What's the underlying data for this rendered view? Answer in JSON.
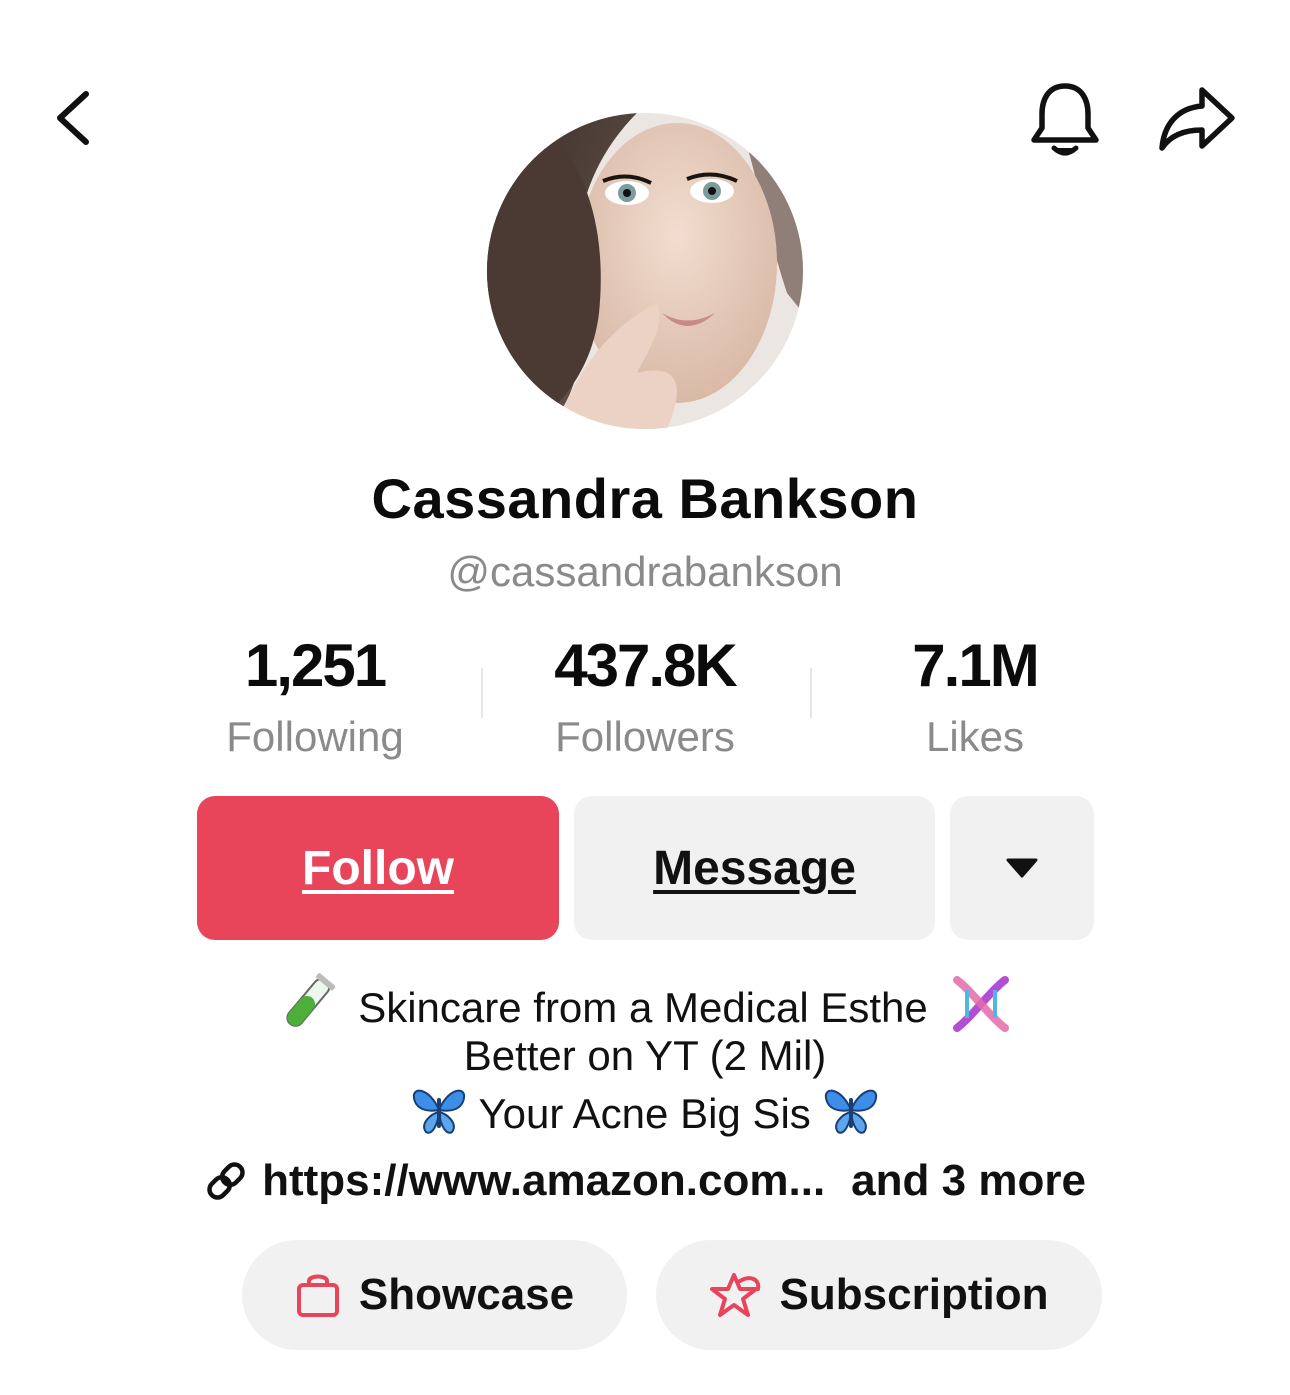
{
  "header": {
    "back_icon": "chevron-left-icon",
    "bell_icon": "bell-icon",
    "share_icon": "share-arrow-icon"
  },
  "profile": {
    "name": "Cassandra Bankson",
    "handle": "@cassandrabankson",
    "avatar_icon": "profile-photo"
  },
  "stats": [
    {
      "value": "1,251",
      "label": "Following"
    },
    {
      "value": "437.8K",
      "label": "Followers"
    },
    {
      "value": "7.1M",
      "label": "Likes"
    }
  ],
  "actions": {
    "follow_label": "Follow",
    "message_label": "Message",
    "more_icon": "caret-down-icon",
    "follow_color": "#e8445a"
  },
  "bio": {
    "line1": "Skincare from a Medical Esthe",
    "line2": "Better on YT (2 Mil)",
    "line3": "Your Acne Big Sis",
    "emoji": [
      "test-tube-emoji",
      "dna-emoji",
      "butterfly-emoji"
    ]
  },
  "link": {
    "url": "https://www.amazon.com...",
    "more": "and 3 more",
    "icon": "link-icon"
  },
  "pills": {
    "showcase": "Showcase",
    "subscription": "Subscription",
    "accent": "#e8445a"
  }
}
